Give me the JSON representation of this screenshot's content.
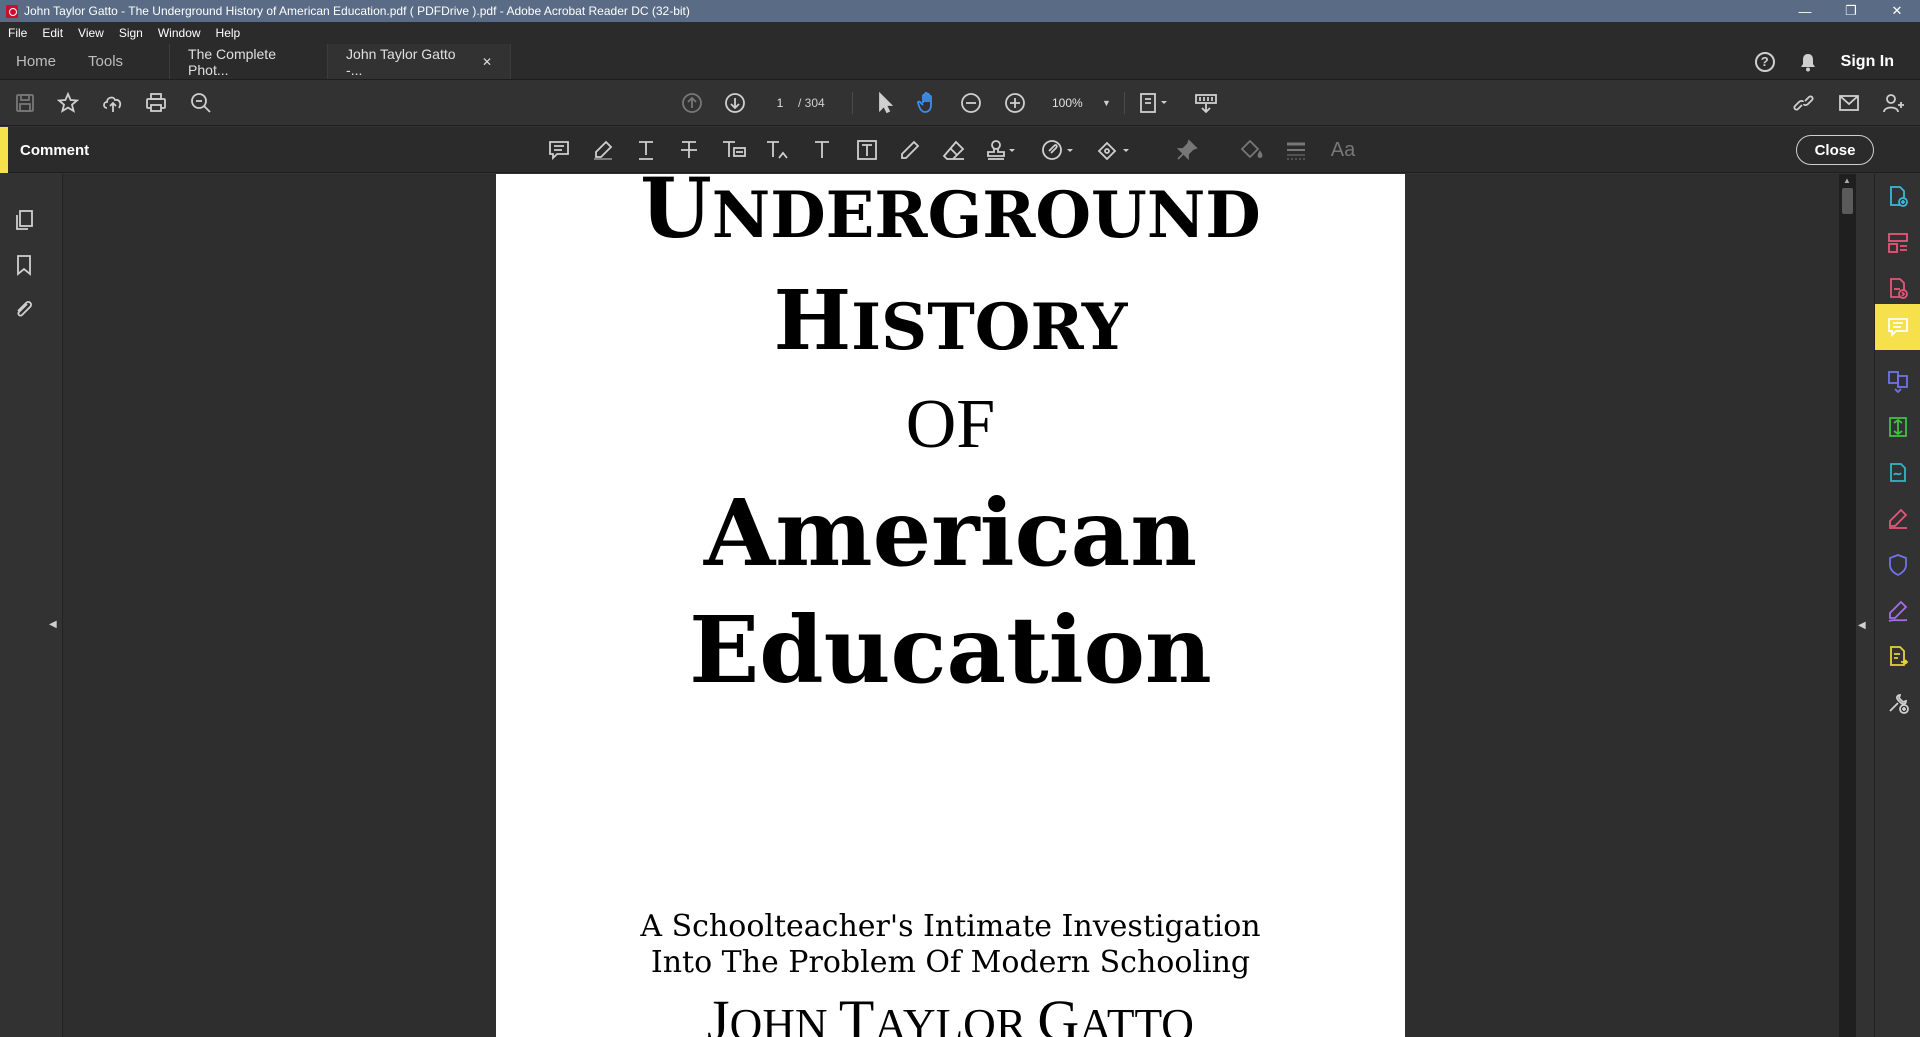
{
  "window": {
    "title": "John Taylor Gatto - The Underground History of American Education.pdf ( PDFDrive ).pdf - Adobe Acrobat Reader DC (32-bit)"
  },
  "menu": [
    "File",
    "Edit",
    "View",
    "Sign",
    "Window",
    "Help"
  ],
  "tabs": {
    "home": "Home",
    "tools": "Tools",
    "doc1": "The Complete Phot...",
    "doc2": "John Taylor Gatto -...",
    "close_glyph": "✕",
    "signin": "Sign In"
  },
  "toolbar": {
    "page_current": "1",
    "page_total": "/ 304",
    "zoom": "100%"
  },
  "comment_bar": {
    "label": "Comment",
    "close": "Close"
  },
  "document": {
    "title_line1_cap": "U",
    "title_line1_rest": "NDERGROUND",
    "title_line2_cap": "H",
    "title_line2_rest": "ISTORY",
    "title_line3": "OF",
    "title_line4": "American",
    "title_line5": "Education",
    "subtitle_line1": "A Schoolteacher's Intimate Investigation",
    "subtitle_line2": "Into The Problem Of Modern Schooling",
    "author_cap1": "J",
    "author_rest1": "OHN ",
    "author_cap2": "T",
    "author_rest2": "AYLOR ",
    "author_cap3": "G",
    "author_rest3": "ATTO"
  },
  "colors": {
    "accent": "#f6e04b",
    "titlebar": "#5a6b85",
    "hand_tool": "#3d8fe8"
  }
}
